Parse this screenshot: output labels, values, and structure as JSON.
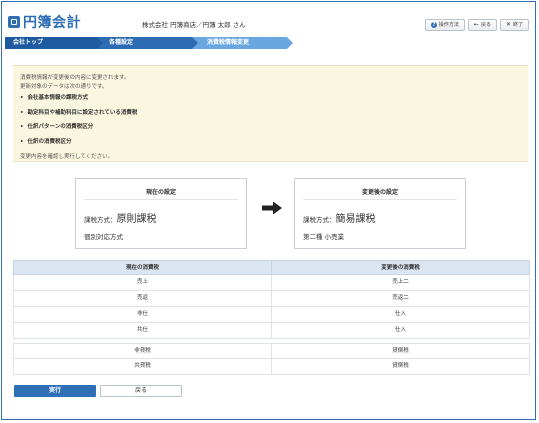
{
  "app": {
    "name": "円簿会計"
  },
  "header": {
    "company": "株式会社 円簿商店／円簿 太郎 さん",
    "help_label": "操作方法",
    "back_label": "戻る",
    "close_label": "終了"
  },
  "breadcrumb": [
    "会社トップ",
    "各種設定",
    "消費税情報変更"
  ],
  "notice": {
    "line1": "消費税情報が変更後の内容に変更されます。",
    "line2": "更新対象のデータは次の通りです。",
    "items": [
      "会社基本情報の課税方式",
      "勘定科目や補助科目に設定されている消費税",
      "仕訳パターンの消費税区分",
      "仕訳の消費税区分"
    ],
    "confirm": "変更内容を確認し実行してください。"
  },
  "current": {
    "title": "現在の設定",
    "tax_label": "課税方式：",
    "tax_value": "原則課税",
    "sub": "個別対応方式"
  },
  "after": {
    "title": "変更後の設定",
    "tax_label": "課税方式：",
    "tax_value": "簡易課税",
    "sub": "第二種 小売業"
  },
  "table": {
    "headers": [
      "現在の消費税",
      "変更後の消費税"
    ],
    "rows": [
      [
        "売上",
        "売上二"
      ],
      [
        "売返",
        "売返二"
      ],
      [
        "非仕",
        "仕入"
      ],
      [
        "共仕",
        "仕入"
      ]
    ],
    "rows2": [
      [
        "非貸税",
        "貸倒税"
      ],
      [
        "共貸税",
        "貸倒税"
      ]
    ]
  },
  "actions": {
    "execute": "実行",
    "back": "戻る"
  },
  "colors": {
    "brand": "#2e6fb5",
    "notice_bg": "#fbf6df",
    "table_header": "#dce6f1"
  }
}
